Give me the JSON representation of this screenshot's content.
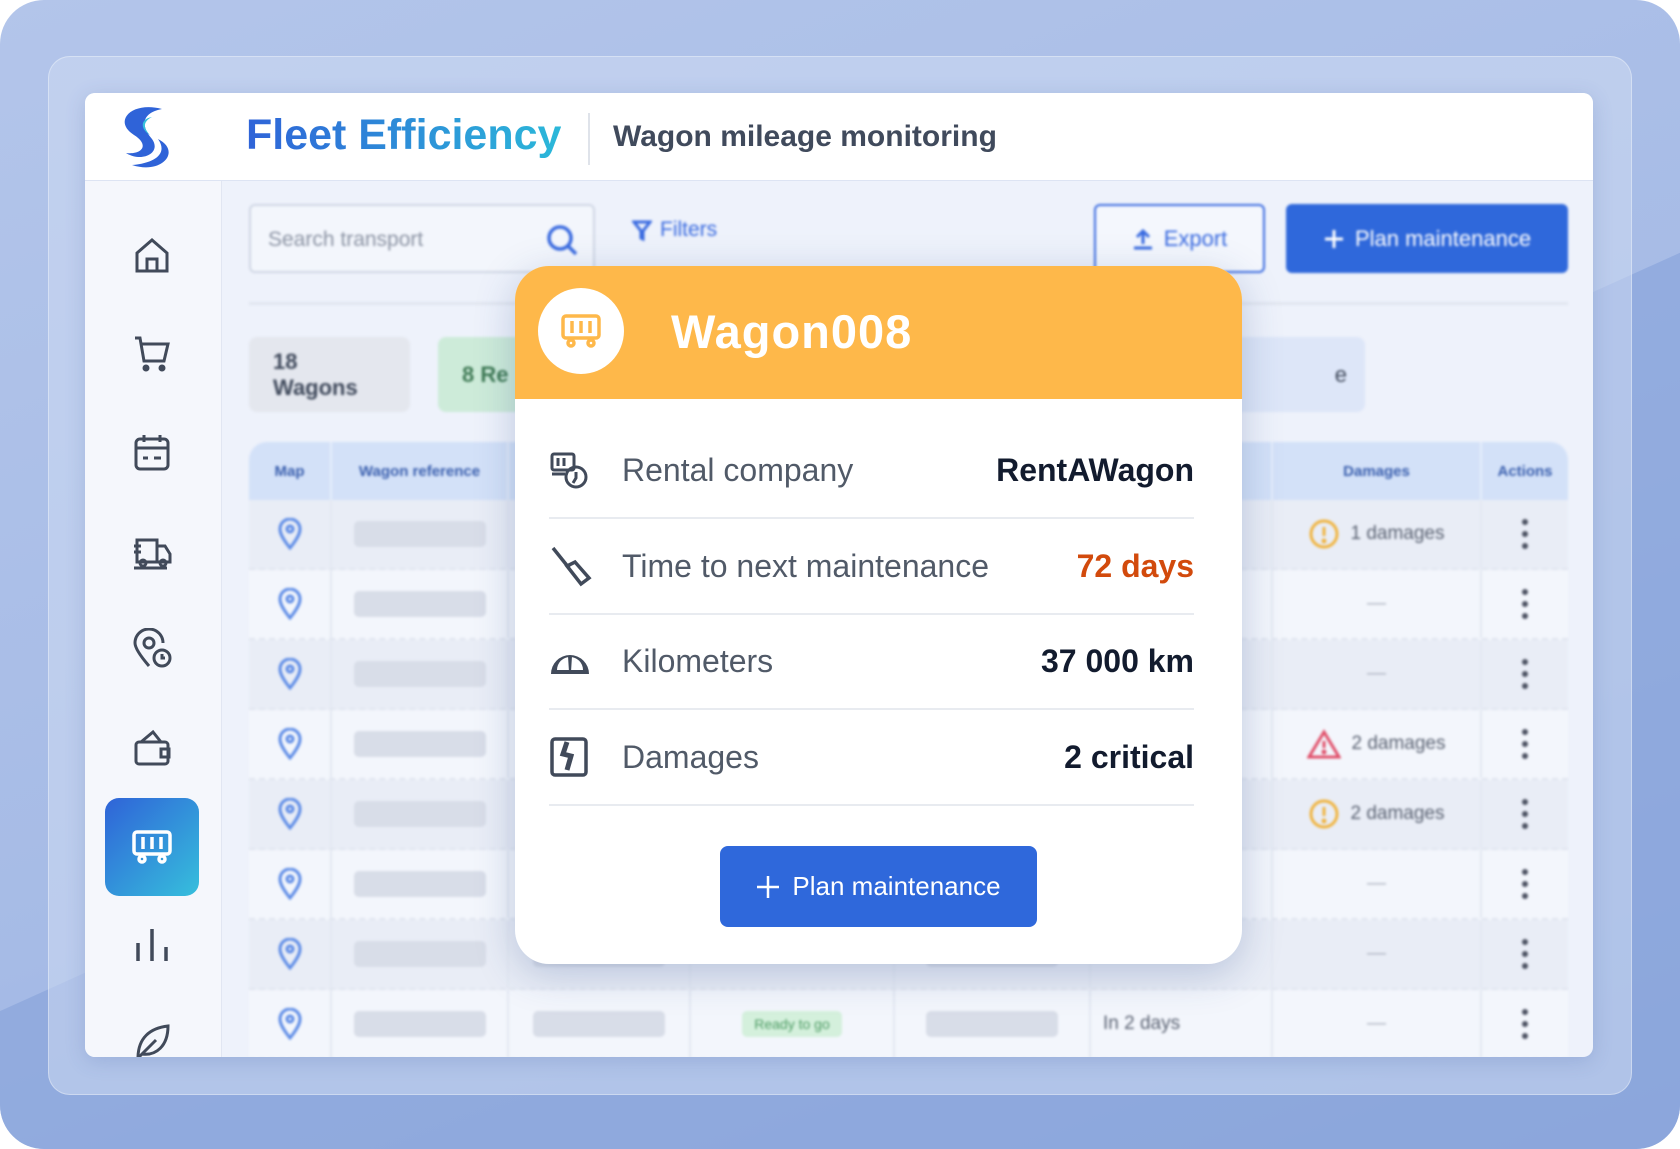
{
  "header": {
    "title": "Fleet Efficiency",
    "subtitle": "Wagon mileage monitoring"
  },
  "sidebar": {
    "items": [
      {
        "icon": "home-icon"
      },
      {
        "icon": "cart-icon"
      },
      {
        "icon": "calendar-icon"
      },
      {
        "icon": "truck-icon"
      },
      {
        "icon": "location-clock-icon"
      },
      {
        "icon": "wallet-icon"
      },
      {
        "icon": "wagon-icon",
        "active": true
      },
      {
        "icon": "bar-chart-icon"
      },
      {
        "icon": "leaf-icon"
      }
    ]
  },
  "toolbar": {
    "search_placeholder": "Search transport",
    "filters_label": "Filters",
    "export_label": "Export",
    "plan_label": "Plan maintenance"
  },
  "chips": [
    {
      "label": "18 Wagons"
    },
    {
      "label": "8 Re"
    },
    {
      "label": "e"
    }
  ],
  "table": {
    "columns": [
      "Map",
      "Wagon reference",
      "",
      "",
      "",
      "",
      "Damages",
      "Actions"
    ],
    "rows": [
      {
        "status": "",
        "next": "",
        "damages": "1 damages",
        "level": "warning"
      },
      {
        "status": "",
        "next": "",
        "damages": "—",
        "level": ""
      },
      {
        "status": "",
        "next": "",
        "damages": "—",
        "level": ""
      },
      {
        "status": "",
        "next": "",
        "damages": "2 damages",
        "level": "critical"
      },
      {
        "status": "",
        "next": "",
        "damages": "2 damages",
        "level": "warning"
      },
      {
        "status": "",
        "next": "",
        "damages": "—",
        "level": ""
      },
      {
        "status": "",
        "next": "",
        "damages": "—",
        "level": ""
      },
      {
        "status": "Ready to go",
        "next": "In 2 days",
        "damages": "—",
        "level": ""
      }
    ]
  },
  "popup": {
    "title": "Wagon008",
    "rows": [
      {
        "label": "Rental company",
        "value": "RentAWagon",
        "icon": "rental-icon"
      },
      {
        "label": "Time to next maintenance",
        "value": "72 days",
        "icon": "wrench-icon",
        "color": "#d24a0c"
      },
      {
        "label": "Kilometers",
        "value": "37 000 km",
        "icon": "speedometer-icon"
      },
      {
        "label": "Damages",
        "value": "2 critical",
        "icon": "damage-icon"
      }
    ],
    "button_label": "Plan maintenance"
  },
  "colors": {
    "accent": "#2f68db",
    "popup_header": "#feb84a",
    "warning": "#f0b440",
    "critical": "#e0506a",
    "highlight": "#d24a0c"
  }
}
